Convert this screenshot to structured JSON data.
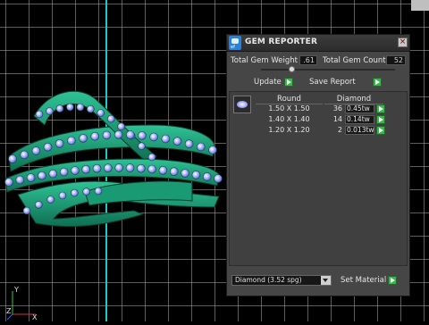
{
  "window": {
    "title": "GEM REPORTER",
    "icon_tag": "ef"
  },
  "totals": {
    "weight_label": "Total Gem Weight",
    "weight_value": ".61",
    "count_label": "Total Gem Count",
    "count_value": "52"
  },
  "toolbar": {
    "update_label": "Update",
    "save_label": "Save Report"
  },
  "table": {
    "headers": [
      "Round",
      "Diamond"
    ],
    "rows": [
      {
        "size": "1.50 X 1.50",
        "count": "36",
        "tw": "0.45tw"
      },
      {
        "size": "1.40 X 1.40",
        "count": "14",
        "tw": "0.14tw"
      },
      {
        "size": "1.20 X 1.20",
        "count": "2",
        "tw": "0.013tw"
      }
    ]
  },
  "material": {
    "selected": "Diamond    (3.52 spg)",
    "set_label": "Set Material"
  },
  "viewport": {
    "axis_labels": {
      "y": "Y",
      "z": "Z",
      "x": "X"
    }
  },
  "colors": {
    "ring": "#1e9e78",
    "gems": "#9ba3ff",
    "panel": "#464646",
    "accent_button": "#39b54a",
    "axis_line": "#1ec8c8"
  },
  "icons": [
    "gem-reporter-app-icon",
    "close-icon",
    "play-arrow-icon",
    "dropdown-arrow-icon",
    "gem-thumbnail"
  ]
}
